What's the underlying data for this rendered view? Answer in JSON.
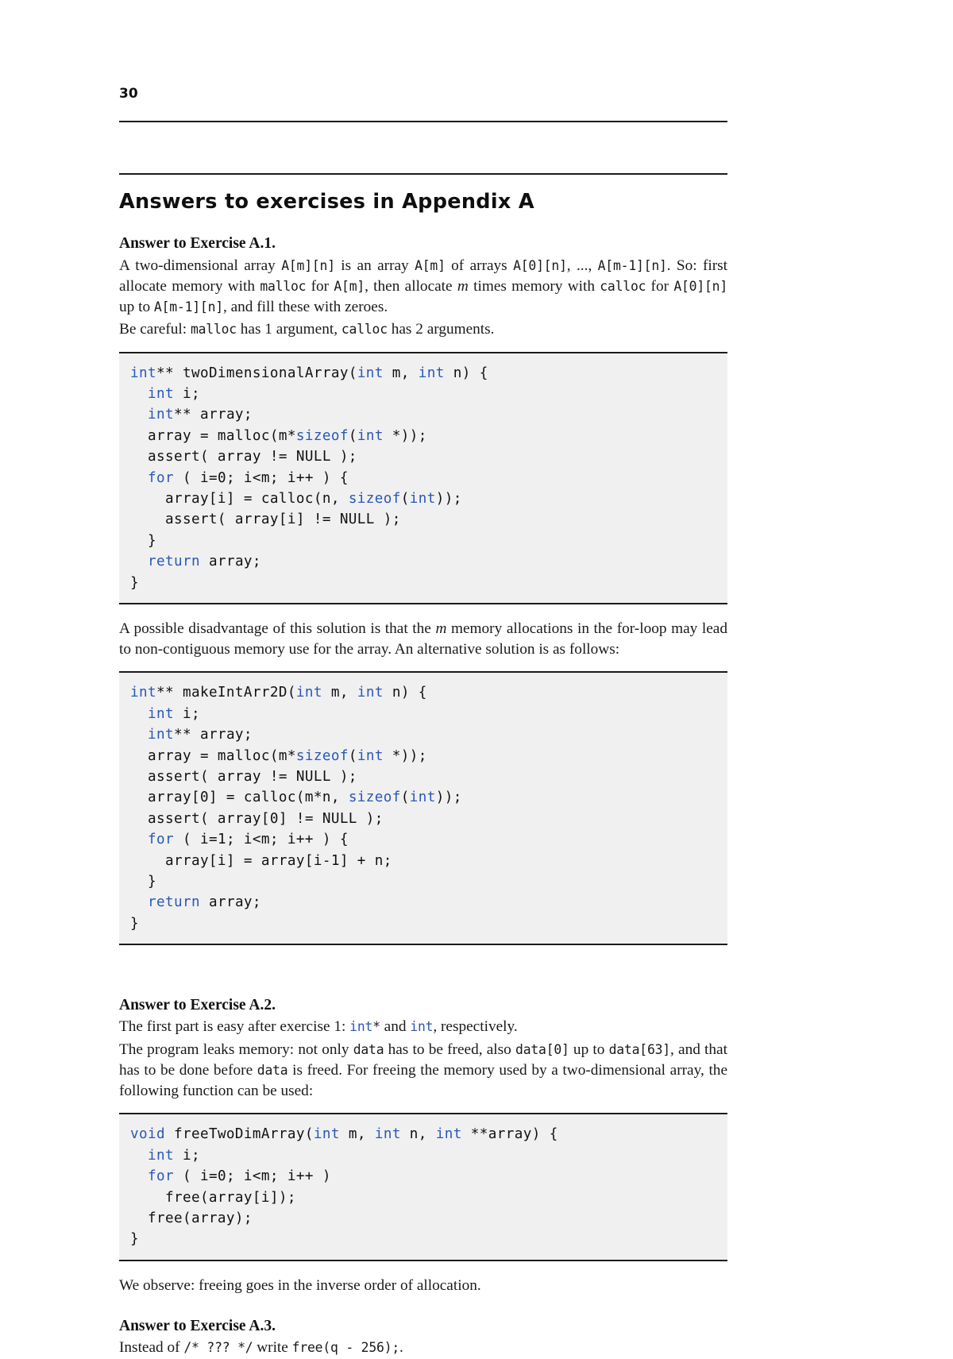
{
  "page": {
    "folio": "30",
    "title": "Answers to exercises in Appendix A"
  },
  "answers": [
    {
      "heading": "Answer to Exercise A.1.",
      "paragraphs": [
        "A two-dimensional array A[m][n] is an array A[m] of arrays A[0][n], ..., A[m-1][n]. So: first allocate memory with malloc for A[m], then allocate m times memory with calloc for A[0][n] up to A[m-1][n], and fill these with zeroes.",
        "Be careful: malloc has 1 argument, calloc has 2 arguments."
      ],
      "code": "int** twoDimensionalArray(int m, int n) {\n  int i;\n  int** array;\n  array = malloc(m*sizeof(int *));\n  assert( array != NULL );\n  for ( i=0; i<m; i++ ) {\n    array[i] = calloc(n, sizeof(int));\n    assert( array[i] != NULL );\n  }\n  return array;\n}",
      "after_paragraph": "A possible disadvantage of this solution is that the m memory allocations in the for-loop may lead to non-contiguous memory use for the array. An alternative solution is as follows:",
      "code2": "int** makeIntArr2D(int m, int n) {\n  int i;\n  int** array;\n  array = malloc(m*sizeof(int *));\n  assert( array != NULL );\n  array[0] = calloc(m*n, sizeof(int));\n  assert( array[0] != NULL );\n  for ( i=1; i<m; i++ ) {\n    array[i] = array[i-1] + n;\n  }\n  return array;\n}"
    },
    {
      "heading": "Answer to Exercise A.2.",
      "paragraphs": [
        "The first part is easy after exercise 1: int* and int, respectively.",
        "The program leaks memory: not only data has to be freed, also data[0] up to data[63], and that has to be done before data is freed. For freeing the memory used by a two-dimensional array, the following function can be used:"
      ],
      "code": "void freeTwoDimArray(int m, int n, int **array) {\n  int i;\n  for ( i=0; i<m; i++ )\n    free(array[i]);\n  free(array);\n}",
      "after_paragraph": "We observe: freeing goes in the inverse order of allocation."
    },
    {
      "heading": "Answer to Exercise A.3.",
      "paragraphs": [
        "Instead of /* ??? */ write free(q - 256);."
      ]
    }
  ],
  "code_keywords": [
    "int",
    "void",
    "for",
    "return",
    "sizeof"
  ],
  "colors": {
    "keyword": "#2a58b5",
    "code_background": "#f0f0f0",
    "rule": "#1b1b1b",
    "text": "#1a1a1a"
  }
}
